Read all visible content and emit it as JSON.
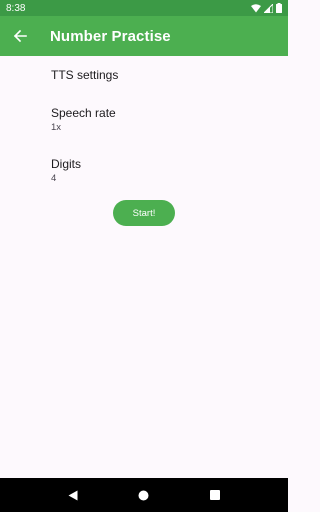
{
  "status_bar": {
    "time": "8:38",
    "icons": [
      "wifi-icon",
      "signal-icon",
      "battery-icon"
    ]
  },
  "app_bar": {
    "back_icon": "arrow-back-icon",
    "title": "Number Practise"
  },
  "settings": {
    "section_header": "TTS settings",
    "items": [
      {
        "title": "Speech rate",
        "summary": "1x"
      },
      {
        "title": "Digits",
        "summary": "4"
      }
    ]
  },
  "start_button": {
    "label": "Start!"
  },
  "nav_bar": {
    "icons": [
      "back-triangle-icon",
      "home-circle-icon",
      "recents-square-icon"
    ]
  },
  "colors": {
    "status_bar": "#3c9a46",
    "app_bar": "#4caf50",
    "accent": "#4caf50",
    "background": "#fdf9fd",
    "nav_bar": "#000000"
  }
}
